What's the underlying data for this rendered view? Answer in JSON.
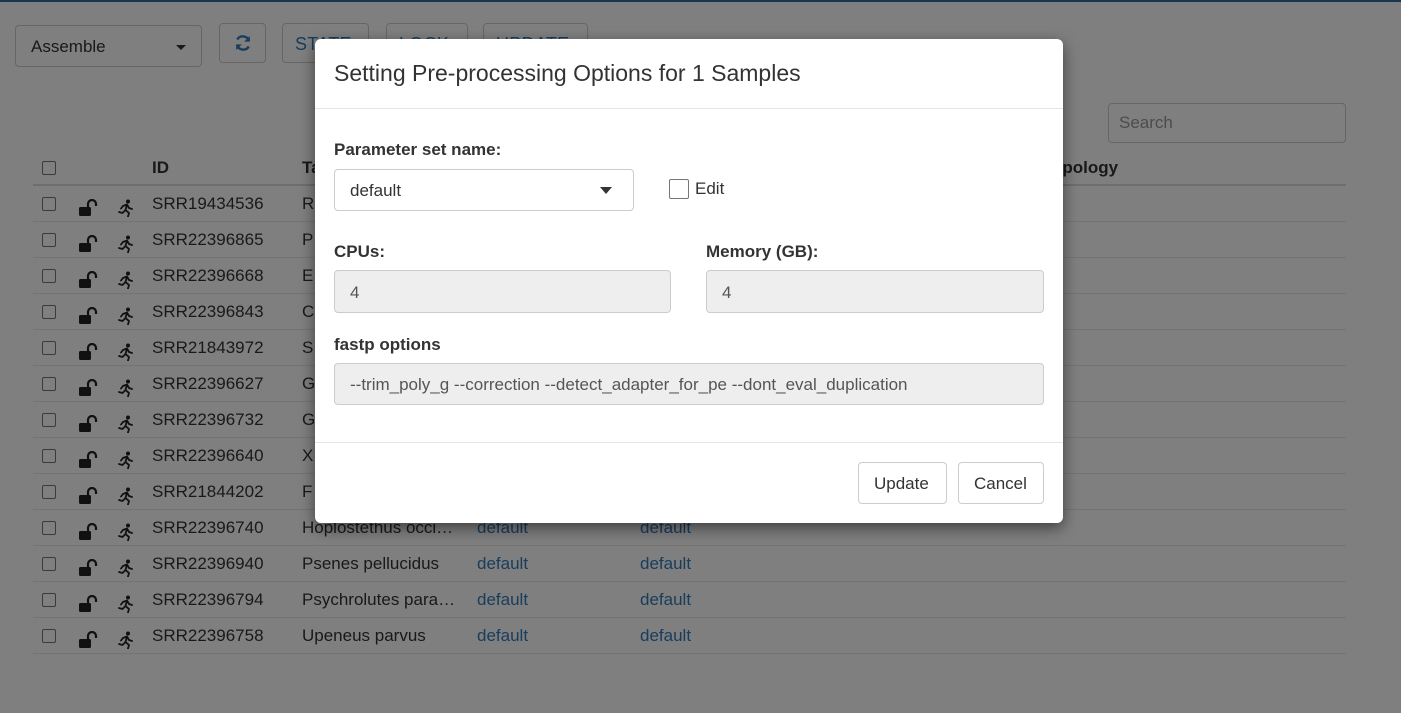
{
  "toolbar": {
    "select_value": "Assemble",
    "refresh_icon": "refresh-icon",
    "buttons": [
      "STATE",
      "LOCK",
      "UPDATE"
    ]
  },
  "search": {
    "placeholder": "Search"
  },
  "table": {
    "headers": {
      "id": "ID",
      "taxon": "Ta",
      "topology": "opology"
    },
    "rows": [
      {
        "id": "SRR19434536",
        "taxon": "R",
        "p1": "",
        "p2": ""
      },
      {
        "id": "SRR22396865",
        "taxon": "P",
        "p1": "",
        "p2": ""
      },
      {
        "id": "SRR22396668",
        "taxon": "E",
        "p1": "",
        "p2": ""
      },
      {
        "id": "SRR22396843",
        "taxon": "C",
        "p1": "",
        "p2": ""
      },
      {
        "id": "SRR21843972",
        "taxon": "S",
        "p1": "",
        "p2": ""
      },
      {
        "id": "SRR22396627",
        "taxon": "G",
        "p1": "",
        "p2": ""
      },
      {
        "id": "SRR22396732",
        "taxon": "G",
        "p1": "",
        "p2": ""
      },
      {
        "id": "SRR22396640",
        "taxon": "X",
        "p1": "",
        "p2": ""
      },
      {
        "id": "SRR21844202",
        "taxon": "F",
        "p1": "",
        "p2": ""
      },
      {
        "id": "SRR22396740",
        "taxon": "Hoplostethus occi…",
        "p1": "default",
        "p2": "default"
      },
      {
        "id": "SRR22396940",
        "taxon": "Psenes pellucidus",
        "p1": "default",
        "p2": "default"
      },
      {
        "id": "SRR22396794",
        "taxon": "Psychrolutes para…",
        "p1": "default",
        "p2": "default"
      },
      {
        "id": "SRR22396758",
        "taxon": "Upeneus parvus",
        "p1": "default",
        "p2": "default"
      }
    ]
  },
  "modal": {
    "title": "Setting Pre-processing Options for 1 Samples",
    "param_set_label": "Parameter set name:",
    "param_set_value": "default",
    "edit_label": "Edit",
    "cpus_label": "CPUs:",
    "cpus_value": "4",
    "memory_label": "Memory (GB):",
    "memory_value": "4",
    "fastp_label": "fastp options",
    "fastp_value": "--trim_poly_g --correction --detect_adapter_for_pe --dont_eval_duplication",
    "update_label": "Update",
    "cancel_label": "Cancel"
  }
}
